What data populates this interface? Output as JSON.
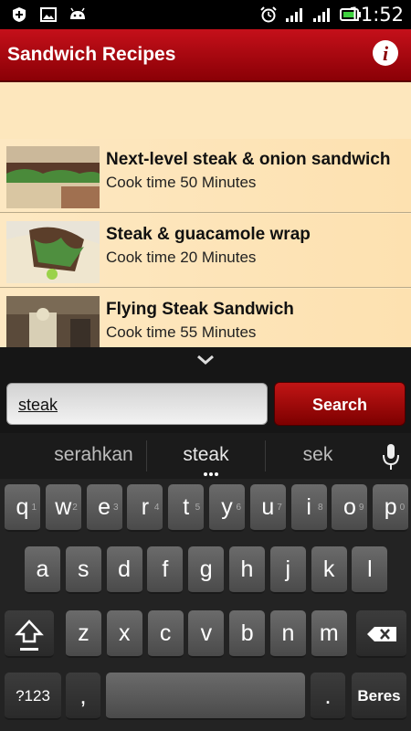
{
  "status": {
    "time": "11:52"
  },
  "app": {
    "title": "Sandwich Recipes"
  },
  "recipes": [
    {
      "title": "Next-level steak & onion sandwich",
      "cook_time": "Cook time 50 Minutes"
    },
    {
      "title": "Steak & guacamole wrap",
      "cook_time": "Cook time 20 Minutes"
    },
    {
      "title": "Flying Steak Sandwich",
      "cook_time": "Cook time 55 Minutes"
    }
  ],
  "search": {
    "value": "steak",
    "button_label": "Search"
  },
  "keyboard": {
    "suggestions": [
      "serahkan",
      "steak",
      "sek"
    ],
    "row1": [
      {
        "k": "q",
        "h": "1"
      },
      {
        "k": "w",
        "h": "2"
      },
      {
        "k": "e",
        "h": "3"
      },
      {
        "k": "r",
        "h": "4"
      },
      {
        "k": "t",
        "h": "5"
      },
      {
        "k": "y",
        "h": "6"
      },
      {
        "k": "u",
        "h": "7"
      },
      {
        "k": "i",
        "h": "8"
      },
      {
        "k": "o",
        "h": "9"
      },
      {
        "k": "p",
        "h": "0"
      }
    ],
    "row2": [
      "a",
      "s",
      "d",
      "f",
      "g",
      "h",
      "j",
      "k",
      "l"
    ],
    "row3": [
      "z",
      "x",
      "c",
      "v",
      "b",
      "n",
      "m"
    ],
    "sym_label": "?123",
    "comma_label": ",",
    "period_label": ".",
    "enter_label": "Beres"
  }
}
